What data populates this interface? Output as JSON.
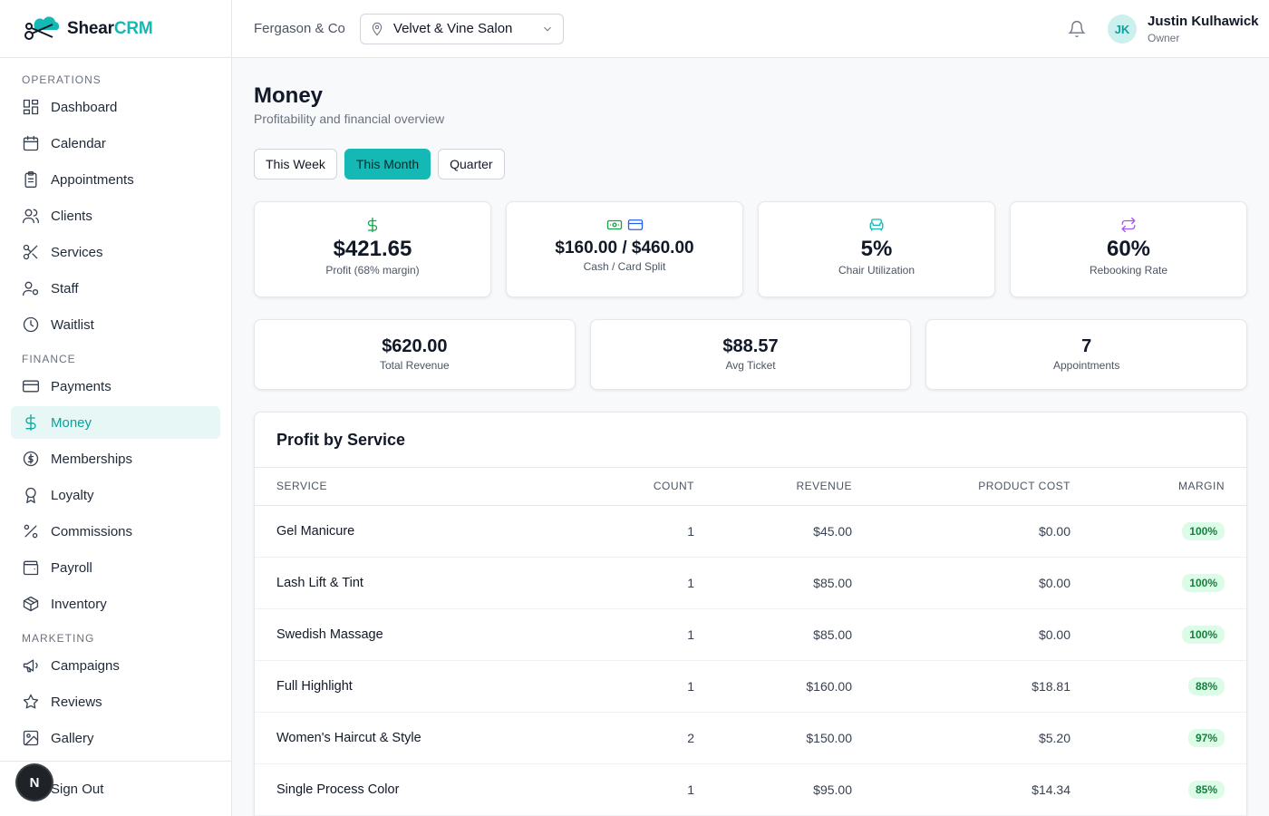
{
  "brand": {
    "name_part1": "Shear",
    "name_part2": "CRM"
  },
  "sidebar": {
    "sections": [
      {
        "title": "OPERATIONS",
        "items": [
          {
            "label": "Dashboard",
            "icon": "grid-icon"
          },
          {
            "label": "Calendar",
            "icon": "calendar-icon"
          },
          {
            "label": "Appointments",
            "icon": "clipboard-icon"
          },
          {
            "label": "Clients",
            "icon": "users-icon"
          },
          {
            "label": "Services",
            "icon": "scissors-icon"
          },
          {
            "label": "Staff",
            "icon": "user-cog-icon"
          },
          {
            "label": "Waitlist",
            "icon": "clock-icon"
          }
        ]
      },
      {
        "title": "FINANCE",
        "items": [
          {
            "label": "Payments",
            "icon": "credit-card-icon"
          },
          {
            "label": "Money",
            "icon": "dollar-icon",
            "active": true
          },
          {
            "label": "Memberships",
            "icon": "coin-icon"
          },
          {
            "label": "Loyalty",
            "icon": "award-icon"
          },
          {
            "label": "Commissions",
            "icon": "percent-icon"
          },
          {
            "label": "Payroll",
            "icon": "wallet-icon"
          },
          {
            "label": "Inventory",
            "icon": "package-icon"
          }
        ]
      },
      {
        "title": "MARKETING",
        "items": [
          {
            "label": "Campaigns",
            "icon": "megaphone-icon"
          },
          {
            "label": "Reviews",
            "icon": "star-icon"
          },
          {
            "label": "Gallery",
            "icon": "image-icon"
          }
        ]
      }
    ],
    "sign_out": "Sign Out",
    "badge_letter": "N"
  },
  "topbar": {
    "org": "Fergason & Co",
    "location": "Velvet & Vine Salon",
    "user": {
      "initials": "JK",
      "name": "Justin Kulhawick",
      "role": "Owner"
    }
  },
  "page": {
    "title": "Money",
    "subtitle": "Profitability and financial overview",
    "ranges": [
      {
        "label": "This Week",
        "active": false
      },
      {
        "label": "This Month",
        "active": true
      },
      {
        "label": "Quarter",
        "active": false
      }
    ]
  },
  "stats_primary": [
    {
      "value": "$421.65",
      "label": "Profit (68% margin)",
      "icon": "dollar-icon",
      "color": "#16a34a"
    },
    {
      "value": "$160.00 / $460.00",
      "label": "Cash / Card Split",
      "icon": "cash-card-icon",
      "color": "#16a34a",
      "color2": "#2563eb"
    },
    {
      "value": "5%",
      "label": "Chair Utilization",
      "icon": "armchair-icon",
      "color": "#14b8b4"
    },
    {
      "value": "60%",
      "label": "Rebooking Rate",
      "icon": "repeat-icon",
      "color": "#a855f7"
    }
  ],
  "stats_secondary": [
    {
      "value": "$620.00",
      "label": "Total Revenue"
    },
    {
      "value": "$88.57",
      "label": "Avg Ticket"
    },
    {
      "value": "7",
      "label": "Appointments"
    }
  ],
  "profit_table": {
    "title": "Profit by Service",
    "columns": [
      "Service",
      "Count",
      "Revenue",
      "Product Cost",
      "Margin"
    ],
    "rows": [
      {
        "service": "Gel Manicure",
        "count": "1",
        "revenue": "$45.00",
        "cost": "$0.00",
        "margin": "100%"
      },
      {
        "service": "Lash Lift & Tint",
        "count": "1",
        "revenue": "$85.00",
        "cost": "$0.00",
        "margin": "100%"
      },
      {
        "service": "Swedish Massage",
        "count": "1",
        "revenue": "$85.00",
        "cost": "$0.00",
        "margin": "100%"
      },
      {
        "service": "Full Highlight",
        "count": "1",
        "revenue": "$160.00",
        "cost": "$18.81",
        "margin": "88%"
      },
      {
        "service": "Women's Haircut & Style",
        "count": "2",
        "revenue": "$150.00",
        "cost": "$5.20",
        "margin": "97%"
      },
      {
        "service": "Single Process Color",
        "count": "1",
        "revenue": "$95.00",
        "cost": "$14.34",
        "margin": "85%"
      }
    ]
  },
  "colors": {
    "accent": "#14b8b4",
    "active_bg": "#e6f7f6",
    "margin_bg": "#dcfce7",
    "margin_text": "#15803d"
  }
}
